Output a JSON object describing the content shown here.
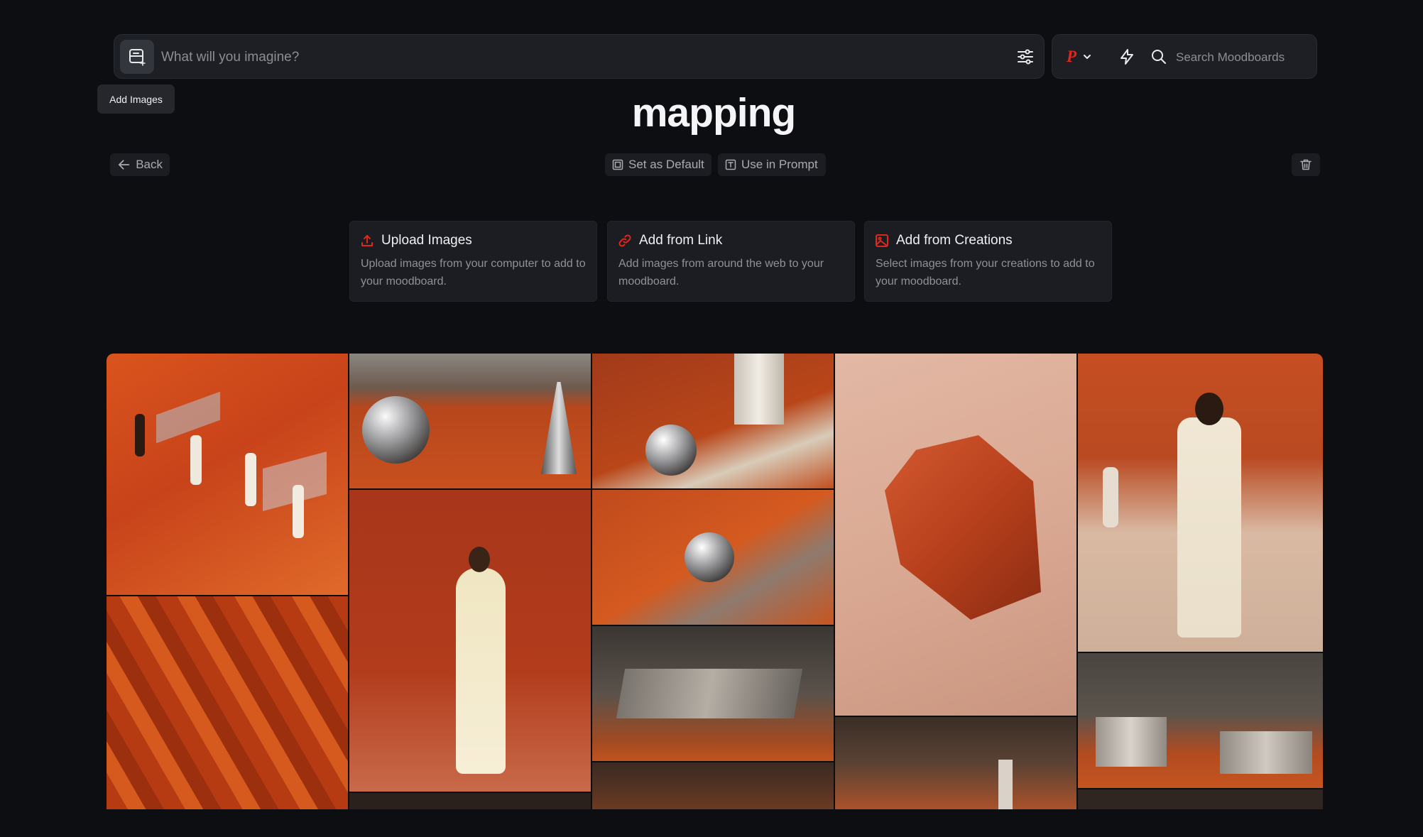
{
  "prompt": {
    "placeholder": "What will you imagine?",
    "value": ""
  },
  "tooltip": {
    "label": "Add Images"
  },
  "toolbar": {
    "profile_letter": "P",
    "search_placeholder": "Search Moodboards"
  },
  "moodboard": {
    "title": "mapping",
    "back_label": "Back",
    "set_default_label": "Set as Default",
    "use_in_prompt_label": "Use in Prompt"
  },
  "add_options": [
    {
      "title": "Upload Images",
      "description": "Upload images from your computer to add to your moodboard.",
      "icon": "upload-icon"
    },
    {
      "title": "Add from Link",
      "description": "Add images from around the web to your moodboard.",
      "icon": "link-icon"
    },
    {
      "title": "Add from Creations",
      "description": "Select images from your creations to add to your moodboard.",
      "icon": "image-icon"
    }
  ],
  "colors": {
    "accent": "#e0271b",
    "background": "#0d0e12",
    "panel": "#1d1f25"
  },
  "gallery": {
    "images": [
      "models walking on orange sand steps",
      "mirrored spheres on red sand with columns",
      "silver sphere on sand near column",
      "red rock on pale sand",
      "man in cream suit in red canyon",
      "orange sand texture",
      "woman in cream outfit by red cliff",
      "mirror sphere on red sand with metal",
      "mirrored block in dark room",
      "dark interior with red sand",
      "mirror cube in concrete room"
    ]
  }
}
